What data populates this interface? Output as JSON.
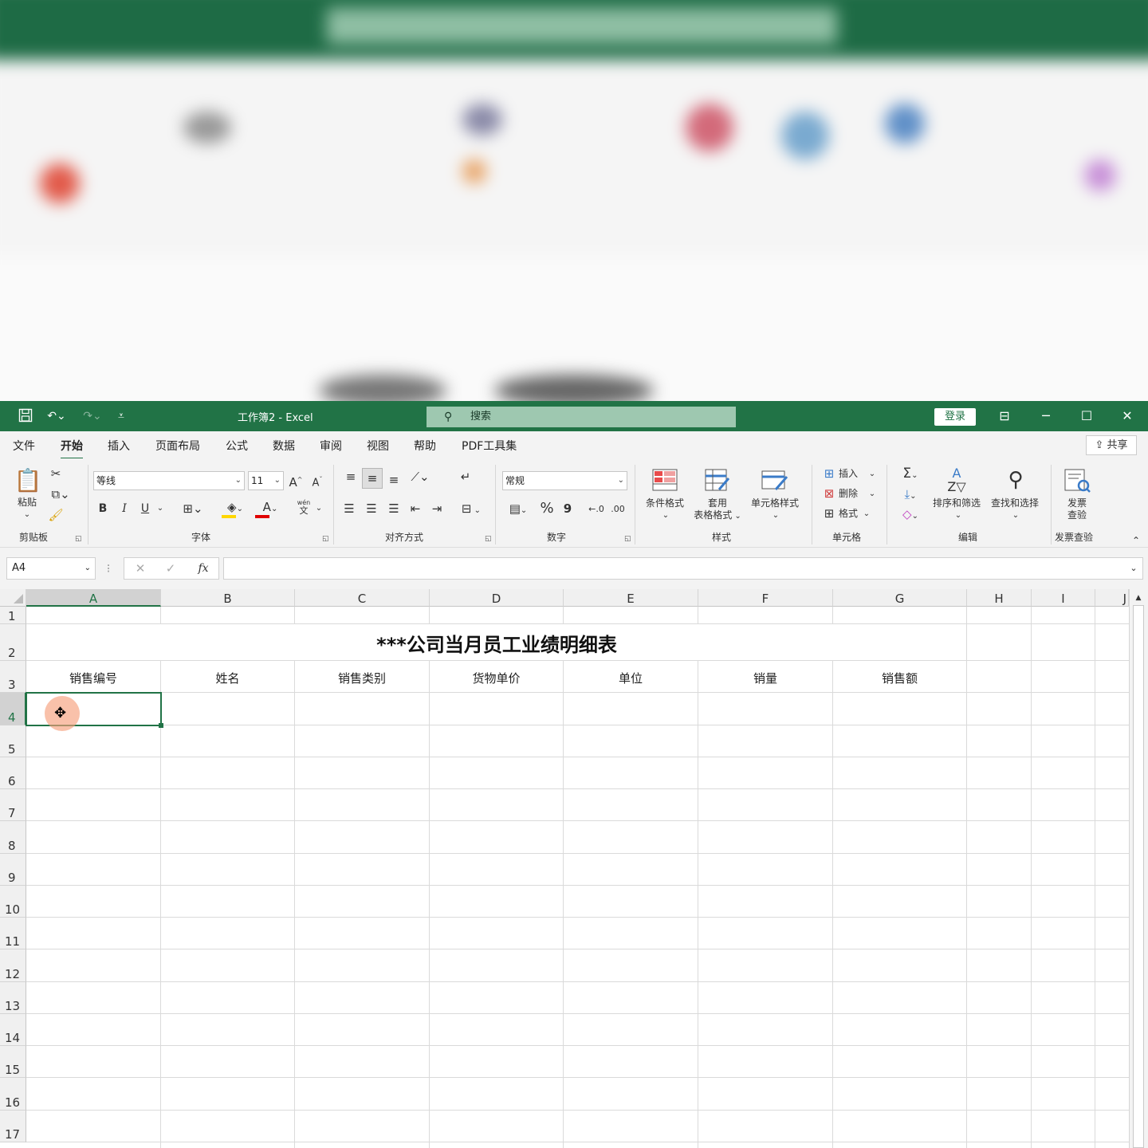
{
  "titlebar": {
    "doc_title": "工作簿2  -  Excel",
    "search_label": "搜索",
    "login_label": "登录",
    "icons": [
      "save-icon",
      "undo-icon",
      "redo-icon",
      "customize-icon",
      "search-icon",
      "ribbon-display-icon",
      "minimize-icon",
      "maximize-icon",
      "close-icon"
    ]
  },
  "menu": {
    "tabs": [
      "文件",
      "开始",
      "插入",
      "页面布局",
      "公式",
      "数据",
      "审阅",
      "视图",
      "帮助",
      "PDF工具集"
    ],
    "active": "开始",
    "share_label": "共享"
  },
  "ribbon": {
    "clipboard": {
      "paste": "粘贴",
      "group": "剪贴板"
    },
    "font": {
      "name": "等线",
      "size": "11",
      "group": "字体",
      "bold": "B",
      "italic": "I",
      "underline": "U",
      "grow": "A",
      "shrink": "A",
      "phonetic_top": "wén",
      "phonetic_bottom": "文"
    },
    "alignment": {
      "group": "对齐方式"
    },
    "number": {
      "format": "常规",
      "group": "数字",
      "percent": "%",
      "comma": "9"
    },
    "styles": {
      "conditional": "条件格式",
      "table_top": "套用",
      "table_bottom": "表格格式",
      "cell_style": "单元格样式",
      "group": "样式"
    },
    "cells": {
      "insert": "插入",
      "delete": "删除",
      "format": "格式",
      "group": "单元格"
    },
    "editing": {
      "sort": "排序和筛选",
      "find": "查找和选择",
      "group": "编辑"
    },
    "invoice": {
      "top": "发票",
      "bottom": "查验",
      "group": "发票查验"
    },
    "colors": {
      "accent": "#217346",
      "font_color": "#e00000",
      "fill_color": "#ffd700"
    }
  },
  "formula_bar": {
    "name_box": "A4",
    "fx": "fx",
    "cancel": "✕",
    "enter": "✓",
    "value": ""
  },
  "sheet": {
    "columns": [
      "A",
      "B",
      "C",
      "D",
      "E",
      "F",
      "G",
      "H",
      "I",
      "J"
    ],
    "rows": [
      "1",
      "2",
      "3",
      "4",
      "5",
      "6",
      "7",
      "8",
      "9",
      "10",
      "11",
      "12",
      "13",
      "14",
      "15",
      "16",
      "17"
    ],
    "title": "***公司当月员工业绩明细表",
    "headers": [
      "销售编号",
      "姓名",
      "销售类别",
      "货物单价",
      "单位",
      "销量",
      "销售额"
    ],
    "active_cell": "A4"
  }
}
